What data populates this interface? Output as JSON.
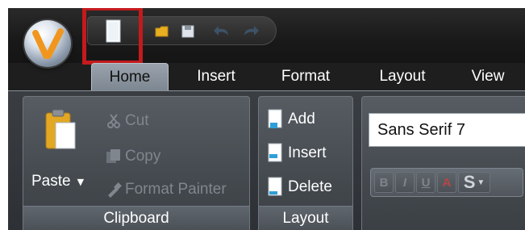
{
  "quick_access": {
    "icons": [
      "new-document-icon",
      "open-folder-icon",
      "save-icon",
      "undo-icon",
      "redo-icon"
    ],
    "highlight_color": "#c41a1d"
  },
  "tabs": [
    {
      "label": "Home",
      "active": true
    },
    {
      "label": "Insert",
      "active": false
    },
    {
      "label": "Format",
      "active": false
    },
    {
      "label": "Layout",
      "active": false
    },
    {
      "label": "View",
      "active": false
    }
  ],
  "clipboard": {
    "paste_label": "Paste",
    "cut_label": "Cut",
    "copy_label": "Copy",
    "format_painter_label": "Format Painter",
    "caption": "Clipboard"
  },
  "layout_group": {
    "add_label": "Add",
    "insert_label": "Insert",
    "delete_label": "Delete",
    "caption": "Layout"
  },
  "font_group": {
    "font_value": "Sans Serif 7",
    "format_buttons": [
      "B",
      "I",
      "U",
      "A",
      "S"
    ]
  }
}
